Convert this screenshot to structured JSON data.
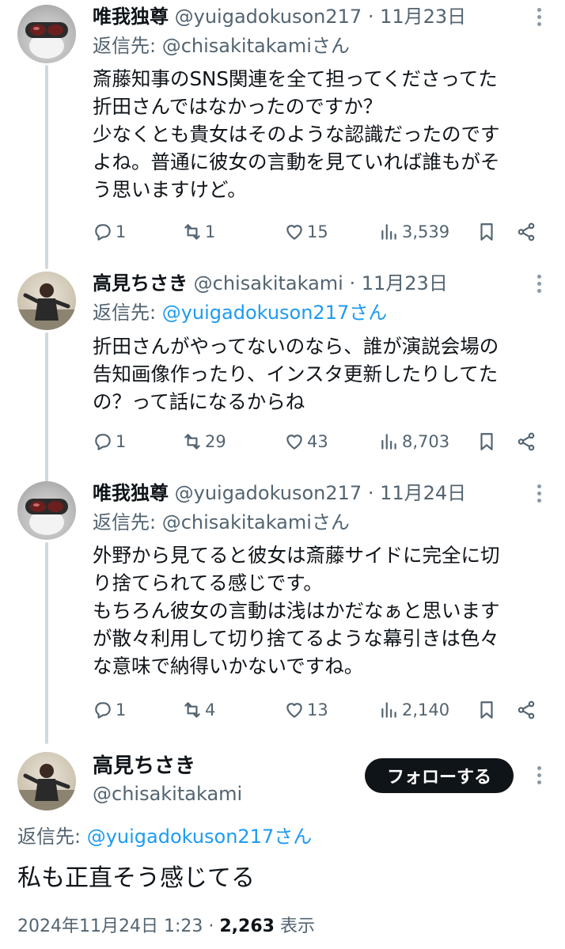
{
  "tweets": [
    {
      "name": "唯我独尊",
      "handle": "@yuigadokuson217",
      "date": "· 11月23日",
      "reply_prefix": "返信先: ",
      "reply_to": "@chisakitakamiさん",
      "text": "斎藤知事のSNS関連を全て担ってくださってた\n折田さんではなかったのですか？\n少なくとも貴女はそのような認識だったのです\nよね。普通に彼女の言動を見ていれば誰もがそ\nう思いますけど。",
      "replies": "1",
      "reposts": "1",
      "likes": "15",
      "views": "3,539"
    },
    {
      "name": "高見ちさき",
      "handle": "@chisakitakami",
      "date": "· 11月23日",
      "reply_prefix": "返信先: ",
      "reply_to": "@yuigadokuson217さん",
      "text": "折田さんがやってないのなら、誰が演説会場の\n告知画像作ったり、インスタ更新したりしてた\nの？って話になるからね",
      "replies": "1",
      "reposts": "29",
      "likes": "43",
      "views": "8,703"
    },
    {
      "name": "唯我独尊",
      "handle": "@yuigadokuson217",
      "date": "· 11月24日",
      "reply_prefix": "返信先: ",
      "reply_to": "@chisakitakamiさん",
      "text": "外野から見てると彼女は斎藤サイドに完全に切\nり捨てられてる感じです。\nもちろん彼女の言動は浅はかだなぁと思います\nが散々利用して切り捨てるような幕引きは色々\nな意味で納得いかないですね。",
      "replies": "1",
      "reposts": "4",
      "likes": "13",
      "views": "2,140"
    }
  ],
  "main": {
    "name": "高見ちさき",
    "handle": "@chisakitakami",
    "follow_label": "フォローする",
    "reply_prefix": "返信先: ",
    "reply_to": "@yuigadokuson217さん",
    "text": "私も正直そう感じてる",
    "timestamp": "2024年11月24日 1:23 · ",
    "views_count": "2,263",
    "views_label": " 表示"
  },
  "colors": {
    "link": "#1d9bf0",
    "muted": "#536471",
    "text": "#0f1419",
    "button": "#0f1419"
  },
  "icons": [
    "reply-icon",
    "repost-icon",
    "like-icon",
    "views-icon",
    "bookmark-icon",
    "share-icon",
    "more-icon"
  ]
}
